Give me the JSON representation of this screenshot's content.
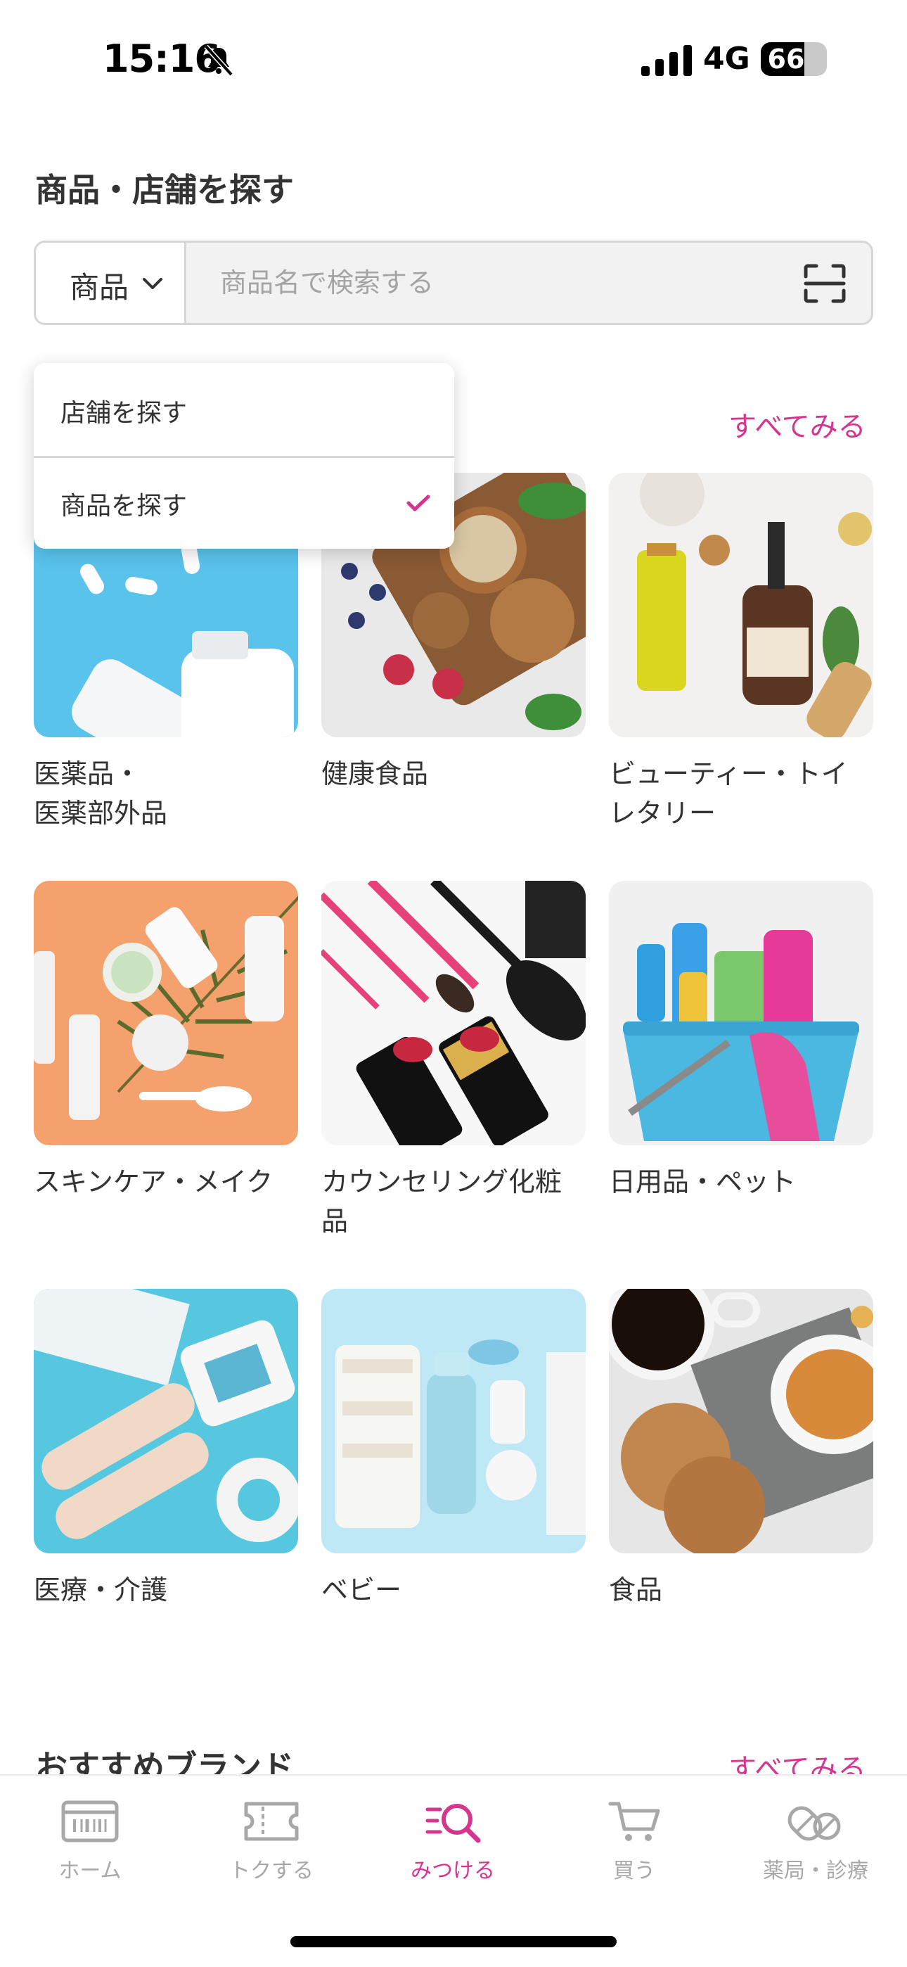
{
  "status_bar": {
    "time": "15:16",
    "network": "4G",
    "battery": "66",
    "battery_level": 0.66
  },
  "header": {
    "title": "商品・店舗を探す"
  },
  "search": {
    "type_label": "商品",
    "placeholder": "商品名で検索する"
  },
  "dropdown": {
    "items": [
      {
        "label": "店舗を探す",
        "selected": false
      },
      {
        "label": "商品を探す",
        "selected": true
      }
    ]
  },
  "categories_section": {
    "see_all_label": "すべてみる"
  },
  "categories": [
    {
      "label_line1": "医薬品・",
      "label_line2": "医薬部外品"
    },
    {
      "label_line1": "健康食品",
      "label_line2": ""
    },
    {
      "label_line1": "ビューティー・トイ",
      "label_line2": "レタリー"
    },
    {
      "label_line1": "スキンケア・メイク",
      "label_line2": ""
    },
    {
      "label_line1": "カウンセリング化粧",
      "label_line2": "品"
    },
    {
      "label_line1": "日用品・ペット",
      "label_line2": ""
    },
    {
      "label_line1": "医療・介護",
      "label_line2": ""
    },
    {
      "label_line1": "ベビー",
      "label_line2": ""
    },
    {
      "label_line1": "食品",
      "label_line2": ""
    }
  ],
  "brands_section": {
    "title": "おすすめブランド",
    "see_all_label": "すべてみる"
  },
  "tab_bar": {
    "tabs": [
      {
        "label": "ホーム",
        "icon": "home-icon",
        "active": false
      },
      {
        "label": "トクする",
        "icon": "coupon-icon",
        "active": false
      },
      {
        "label": "みつける",
        "icon": "search-list-icon",
        "active": true
      },
      {
        "label": "買う",
        "icon": "cart-icon",
        "active": false
      },
      {
        "label": "薬局・診療",
        "icon": "pill-icon",
        "active": false
      }
    ]
  },
  "colors": {
    "accent": "#d4368f",
    "inactive": "#a8a8a8",
    "text": "#333333",
    "border": "#d6d6d6"
  }
}
